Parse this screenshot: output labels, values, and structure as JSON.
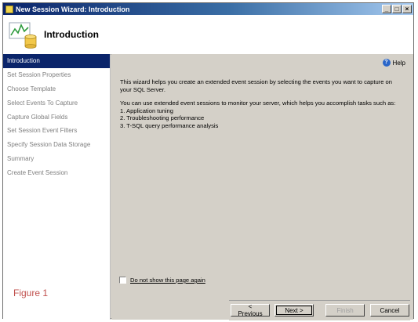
{
  "window": {
    "title": "New Session Wizard: Introduction",
    "controls": [
      "_",
      "□",
      "×"
    ]
  },
  "header": {
    "title": "Introduction",
    "icon": "wizard-chart-database-icon"
  },
  "sidebar": {
    "items": [
      {
        "label": "Introduction",
        "active": true
      },
      {
        "label": "Set Session Properties",
        "active": false
      },
      {
        "label": "Choose Template",
        "active": false
      },
      {
        "label": "Select Events To Capture",
        "active": false
      },
      {
        "label": "Capture Global Fields",
        "active": false
      },
      {
        "label": "Set Session Event Filters",
        "active": false
      },
      {
        "label": "Specify Session Data Storage",
        "active": false
      },
      {
        "label": "Summary",
        "active": false
      },
      {
        "label": "Create Event Session",
        "active": false
      }
    ]
  },
  "content": {
    "help_label": "Help",
    "paragraph1": "This wizard helps you create an extended event session by selecting the events you want to capture on your SQL Server.",
    "paragraph2_intro": "You can use extended event sessions to monitor your server, which helps you accomplish tasks such as:",
    "tasks": [
      "1. Application tuning",
      "2. Troubleshooting performance",
      "3. T-SQL query performance analysis"
    ],
    "checkbox_label": "Do not show this page again",
    "checkbox_checked": false
  },
  "buttons": {
    "previous": "< Previous",
    "next": "Next >",
    "finish": "Finish",
    "cancel": "Cancel"
  },
  "figure_label": "Figure 1",
  "colors": {
    "title_bar": "#0a246a",
    "active_item": "#0a246a",
    "figure_label": "#c0504d",
    "dialog_face": "#d4d0c8"
  }
}
